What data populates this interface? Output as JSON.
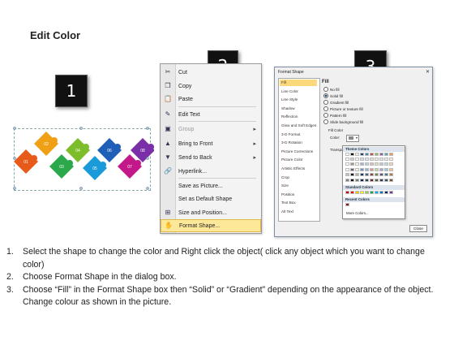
{
  "title": "Edit Color",
  "badges": {
    "one": "1",
    "two": "2",
    "three": "3"
  },
  "puzzle": {
    "pieces": [
      {
        "label": "01",
        "color": "#e85a1a"
      },
      {
        "label": "02",
        "color": "#f0a014"
      },
      {
        "label": "03",
        "color": "#2aa84a"
      },
      {
        "label": "04",
        "color": "#7bbd2a"
      },
      {
        "label": "05",
        "color": "#1a9ad8"
      },
      {
        "label": "06",
        "color": "#1f5fb8"
      },
      {
        "label": "07",
        "color": "#c2188a"
      },
      {
        "label": "08",
        "color": "#7a2fa8"
      }
    ]
  },
  "context_menu": {
    "items": [
      {
        "label": "Cut",
        "icon": "scissors-icon"
      },
      {
        "label": "Copy",
        "icon": "copy-icon"
      },
      {
        "label": "Paste",
        "icon": "paste-icon"
      },
      {
        "label": "Edit Text",
        "icon": "edit-text-icon"
      },
      {
        "label": "Group",
        "icon": "group-icon"
      },
      {
        "label": "Bring to Front",
        "icon": "bring-front-icon"
      },
      {
        "label": "Send to Back",
        "icon": "send-back-icon"
      },
      {
        "label": "Hyperlink...",
        "icon": "hyperlink-icon"
      },
      {
        "label": "Save as Picture...",
        "icon": ""
      },
      {
        "label": "Set as Default Shape",
        "icon": ""
      },
      {
        "label": "Size and Position...",
        "icon": "size-position-icon"
      },
      {
        "label": "Format Shape...",
        "icon": "format-shape-icon"
      }
    ]
  },
  "dialog": {
    "title": "Format Shape",
    "close_glyph": "✕",
    "nav": [
      "Fill",
      "Line Color",
      "Line Style",
      "Shadow",
      "Reflection",
      "Glow and Soft Edges",
      "3-D Format",
      "3-D Rotation",
      "Picture Corrections",
      "Picture Color",
      "Artistic Effects",
      "Crop",
      "Size",
      "Position",
      "Text Box",
      "Alt Text"
    ],
    "fill_heading": "Fill",
    "options": [
      "No fill",
      "Solid fill",
      "Gradient fill",
      "Picture or texture fill",
      "Pattern fill",
      "Slide background fill"
    ],
    "fill_color": "Fill Color",
    "color_label": "Color:",
    "transparency_label": "Transparency:",
    "palette": {
      "theme_heading": "Theme Colors",
      "standard_heading": "Standard Colors",
      "recent_heading": "Recent Colors",
      "more": "More Colors...",
      "theme_top": [
        "#ffffff",
        "#000000",
        "#eeece1",
        "#1f497d",
        "#4f81bd",
        "#c0504d",
        "#9bbb59",
        "#8064a2",
        "#4bacc6",
        "#f79646"
      ],
      "standard": [
        "#c00000",
        "#ff0000",
        "#ffc000",
        "#ffff00",
        "#92d050",
        "#00b050",
        "#00b0f0",
        "#0070c0",
        "#002060",
        "#7030a0"
      ],
      "recent": [
        "#8b1a1a"
      ]
    },
    "close_button": "Close"
  },
  "steps": [
    {
      "n": "1.",
      "text": "Select the shape to change the color and Right click the object( click any object which you want to change color)"
    },
    {
      "n": "2.",
      "text": "Choose Format Shape in the dialog box."
    },
    {
      "n": "3.",
      "text": "Choose “Fill” in the Format Shape box then “Solid” or “Gradient” depending on the appearance of the object. Change colour as shown in the picture."
    }
  ]
}
